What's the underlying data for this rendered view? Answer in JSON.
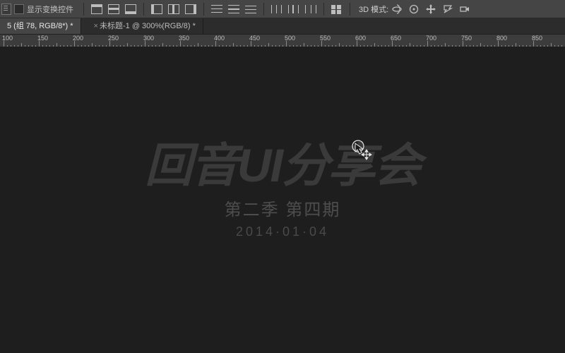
{
  "optionsbar": {
    "transform_controls_label": "显示变换控件",
    "mode3d_label": "3D 模式:"
  },
  "tabs": [
    {
      "label": "5 (组 78, RGB/8*) *",
      "active": true
    },
    {
      "label": "未标题-1 @ 300%(RGB/8) *",
      "active": false
    }
  ],
  "ruler": {
    "start": 100,
    "end": 850,
    "step": 50,
    "minor_per_major": 10
  },
  "artwork": {
    "title": "回音UI分享会",
    "subtitle": "第二季 第四期",
    "date": "2014·01·04"
  }
}
